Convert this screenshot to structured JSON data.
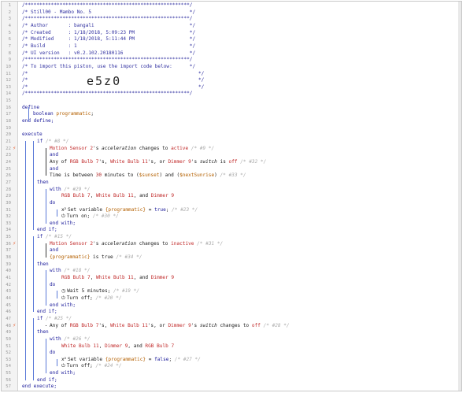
{
  "header": {
    "stars": "/*********************************************************/",
    "title": "/* Still00 - Mambo No. 5                                  */",
    "author": "/* Author       : bangali                                 */",
    "created": "/* Created      : 1/18/2018, 5:09:23 PM                   */",
    "modified": "/* Modified     : 1/18/2018, 5:11:44 PM                   */",
    "build": "/* Build        : 1                                       */",
    "ui_version": "/* UI version   : v0.2.102.20180116                       */",
    "import_note": "/* To import this piston, use the import code below:      */",
    "blank_open": "/*",
    "blank_close": "*/",
    "import_code": "e5z0"
  },
  "code": {
    "define": "define",
    "boolean_kw": "boolean",
    "programmatic_decl": "programmatic",
    "semicolon": ";",
    "end_define": "end define;",
    "execute": "execute",
    "if": "if",
    "then": "then",
    "do": "do",
    "with": "with",
    "and": "and",
    "end_if": "end if;",
    "end_with": "end with;",
    "end_execute": "end execute;",
    "motion_sensor": "Motion Sensor 2",
    "apostrophe_s": "'s",
    "acceleration": "acceleration",
    "changes_to": "changes to",
    "active": "active",
    "inactive": "inactive",
    "any_of": "Any of",
    "rgb_bulb": "RGB Bulb 7",
    "white_bulb": "White Bulb 11",
    "dimmer": "Dimmer 9",
    "or": "or",
    "switch_attr": "switch",
    "is": "is",
    "off": "off",
    "time_is_between": "Time is between",
    "thirty": "30",
    "minutes_to": "minutes to",
    "sunset": "$sunset",
    "next_sunrise": "$nextSunrise",
    "set_variable": "Set variable",
    "programmatic_var": "{programmatic}",
    "true_val": "true",
    "false_val": "false",
    "turn_on": "Turn on;",
    "turn_off": "Turn off;",
    "wait": "Wait 5 minutes;",
    "is_true": "is true",
    "equals": "=",
    "comments": {
      "c9": "/* #9 */",
      "c8": "/* #8 */",
      "c32": "/* #32 */",
      "c33": "/* #33 */",
      "c29": "/* #29 */",
      "c23": "/* #23 */",
      "c30": "/* #30 */",
      "c15": "/* #15 */",
      "c31": "/* #31 */",
      "c34": "/* #34 */",
      "c18": "/* #18 */",
      "c19": "/* #19 */",
      "c20": "/* #20 */",
      "c25": "/* #25 */",
      "c28": "/* #28 */",
      "c26": "/* #26 */",
      "c27": "/* #27 */",
      "c24": "/* #24 */"
    }
  },
  "line_numbers": [
    "1",
    "2",
    "3",
    "4",
    "5",
    "6",
    "7",
    "8",
    "9",
    "10",
    "11",
    "12",
    "13",
    "14",
    "15",
    "16",
    "17",
    "18",
    "19",
    "20",
    "21",
    "22",
    "23",
    "24",
    "25",
    "26",
    "27",
    "28",
    "29",
    "30",
    "31",
    "32",
    "33",
    "34",
    "35",
    "36",
    "37",
    "38",
    "39",
    "40",
    "41",
    "42",
    "43",
    "44",
    "45",
    "46",
    "47",
    "48",
    "49",
    "50",
    "51",
    "52",
    "53",
    "54",
    "55",
    "56",
    "57"
  ],
  "icons": {
    "breakpoint": "lightning-icon",
    "set_variable": "variable-x-icon",
    "power": "power-icon",
    "wait": "clock-icon"
  },
  "colors": {
    "comment": "#3030a0",
    "keyword": "#1a1a9a",
    "device": "#c02828",
    "variable": "#b46000",
    "inline_comment": "#aaaaaa",
    "guide_blue": "#5a79d8",
    "breakpoint": "#e85a2a"
  }
}
